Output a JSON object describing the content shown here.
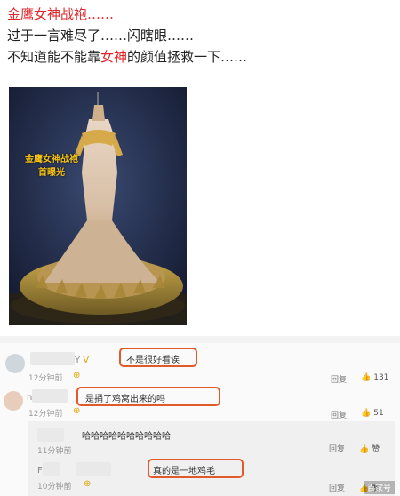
{
  "post": {
    "line1": "金鹰女神战袍……",
    "line2": "过于一言难尽了……闪瞎眼……",
    "line3_pre": "不知道能不能靠",
    "line3_red": "女神",
    "line3_post": "的颜值拯救一下……"
  },
  "image": {
    "caption_line1": "金鹰女神战袍",
    "caption_line2": "首曝光"
  },
  "comments": [
    {
      "name": "Y",
      "text": "不是很好看诶",
      "time": "12分钟前",
      "reply": "回复",
      "likes": "131"
    },
    {
      "name": "h",
      "text": "是捅了鸡窝出来的吗",
      "time": "12分钟前",
      "reply": "回复",
      "likes": "51"
    }
  ],
  "replies": [
    {
      "text": "哈哈哈哈哈哈哈哈哈哈",
      "time": "11分钟前",
      "reply": "回复",
      "likes": "赞"
    },
    {
      "name": "F",
      "text": "真的是一地鸡毛",
      "time": "10分钟前",
      "reply": "回复",
      "likes": "赞"
    }
  ],
  "watermark": "百家号"
}
